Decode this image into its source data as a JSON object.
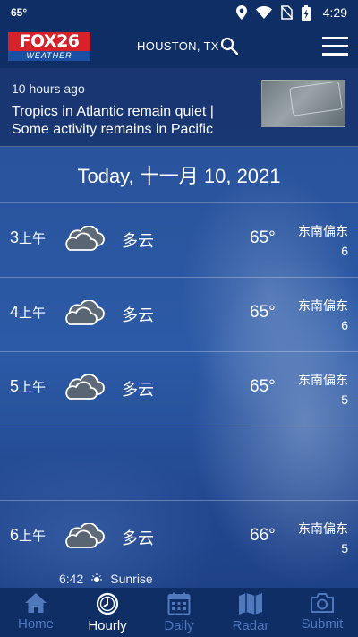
{
  "status_bar": {
    "left_temp": "65°",
    "time": "4:29"
  },
  "header": {
    "logo_top": "FOX26",
    "logo_bottom": "WEATHER",
    "location": "HOUSTON, TX"
  },
  "news": {
    "time_ago": "10 hours ago",
    "headline": "Tropics in Atlantic remain quiet | Some activity remains in Pacific"
  },
  "date_label": "Today, 十一月 10, 2021",
  "hours": [
    {
      "hour": "3",
      "suffix": "上午",
      "icon": "cloudy-icon",
      "condition": "多云",
      "temp": "65°",
      "wind_dir": "东南偏东",
      "wind_speed": "6"
    },
    {
      "hour": "4",
      "suffix": "上午",
      "icon": "cloudy-icon",
      "condition": "多云",
      "temp": "65°",
      "wind_dir": "东南偏东",
      "wind_speed": "6"
    },
    {
      "hour": "5",
      "suffix": "上午",
      "icon": "cloudy-icon",
      "condition": "多云",
      "temp": "65°",
      "wind_dir": "东南偏东",
      "wind_speed": "5"
    },
    {
      "hour": "6",
      "suffix": "上午",
      "icon": "cloudy-icon",
      "condition": "多云",
      "temp": "66°",
      "wind_dir": "东南偏东",
      "wind_speed": "5"
    }
  ],
  "sunrise": {
    "time": "6:42",
    "label": "Sunrise"
  },
  "nav": {
    "items": [
      {
        "label": "Home",
        "icon": "home-icon",
        "active": false
      },
      {
        "label": "Hourly",
        "icon": "clock-icon",
        "active": true
      },
      {
        "label": "Daily",
        "icon": "calendar-icon",
        "active": false
      },
      {
        "label": "Radar",
        "icon": "map-icon",
        "active": false
      },
      {
        "label": "Submit",
        "icon": "camera-icon",
        "active": false
      }
    ]
  },
  "colors": {
    "header_bg": "#0f2e66",
    "nav_inactive": "#4f78bd",
    "logo_red": "#d8222a"
  }
}
